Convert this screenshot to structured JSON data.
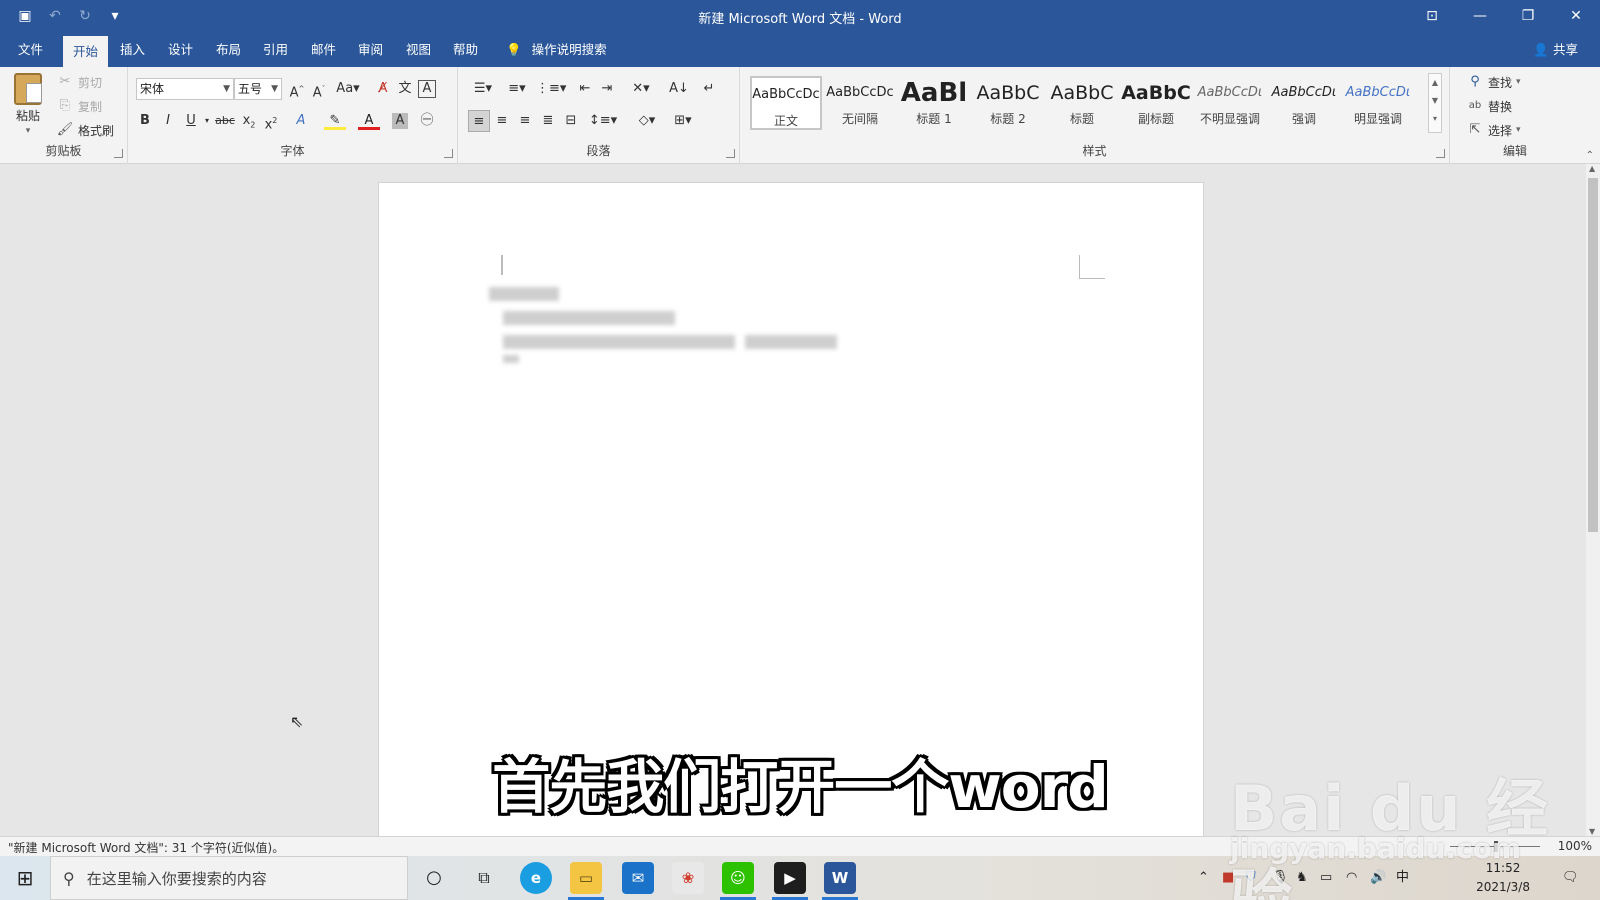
{
  "window": {
    "title": "新建 Microsoft Word 文档 - Word",
    "controls": [
      "ribbon-display-options",
      "minimize",
      "restore",
      "close"
    ]
  },
  "qat": {
    "icons": [
      "save-icon",
      "undo-icon",
      "redo-icon",
      "customize-icon"
    ]
  },
  "tabs": [
    {
      "label": "文件"
    },
    {
      "label": "开始",
      "active": true
    },
    {
      "label": "插入"
    },
    {
      "label": "设计"
    },
    {
      "label": "布局"
    },
    {
      "label": "引用"
    },
    {
      "label": "邮件"
    },
    {
      "label": "审阅"
    },
    {
      "label": "视图"
    },
    {
      "label": "帮助"
    }
  ],
  "tellme": {
    "label": "操作说明搜索"
  },
  "share": {
    "label": "共享"
  },
  "ribbon": {
    "clipboard": {
      "group_label": "剪贴板",
      "paste": "粘贴",
      "cut": "剪切",
      "copy": "复制",
      "format_painter": "格式刷"
    },
    "font": {
      "group_label": "字体",
      "font_name": "宋体",
      "font_size": "五号"
    },
    "paragraph": {
      "group_label": "段落"
    },
    "styles": {
      "group_label": "样式",
      "items": [
        {
          "sample": "AaBbCcDc",
          "name": "正文",
          "selected": true
        },
        {
          "sample": "AaBbCcDc",
          "name": "无间隔"
        },
        {
          "sample": "AaBl",
          "name": "标题 1"
        },
        {
          "sample": "AaBbC",
          "name": "标题 2"
        },
        {
          "sample": "AaBbC",
          "name": "标题"
        },
        {
          "sample": "AaBbC",
          "name": "副标题"
        },
        {
          "sample": "AaBbCcDι",
          "name": "不明显强调"
        },
        {
          "sample": "AaBbCcDι",
          "name": "强调"
        },
        {
          "sample": "AaBbCcDι",
          "name": "明显强调"
        }
      ]
    },
    "editing": {
      "group_label": "编辑",
      "find": "查找",
      "replace": "替换",
      "select": "选择"
    }
  },
  "status": {
    "text": "\"新建 Microsoft Word 文档\": 31 个字符(近似值)。",
    "zoom": "100%"
  },
  "taskbar": {
    "search_placeholder": "在这里输入你要搜索的内容",
    "apps": [
      "cortana-icon",
      "task-view-icon",
      "edge-icon",
      "file-explorer-icon",
      "mail-icon",
      "paint-icon",
      "wechat-icon",
      "video-icon",
      "word-icon"
    ],
    "time": "11:52",
    "date": "2021/3/8",
    "ime": "中"
  },
  "subtitle": "首先我们打开一个word",
  "watermark": {
    "brand": "Bai du 经验",
    "url": "jingyan.baidu.com"
  },
  "colors": {
    "word_blue": "#2b579a",
    "ribbon_bg": "#f3f3f3",
    "workspace_bg": "#e6e6e6"
  }
}
